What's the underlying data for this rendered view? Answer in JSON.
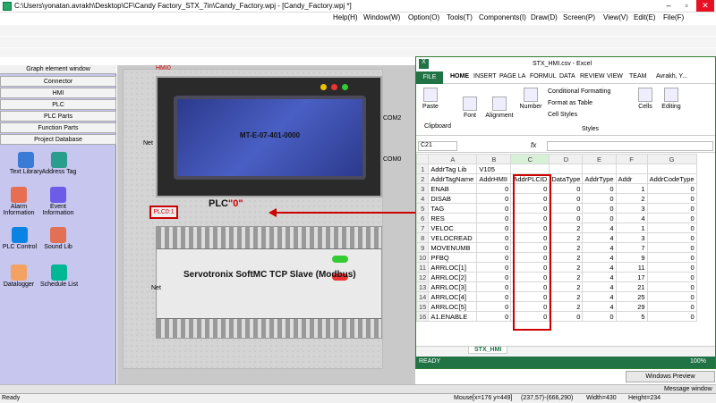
{
  "app": {
    "title": "C:\\Users\\yonatan.avrakh\\Desktop\\CF\\Candy Factory_STX_7in\\Candy_Factory.wpj - [Candy_Factory.wpj *]"
  },
  "menu": [
    "Help(H)",
    "Window(W)",
    "Option(O)",
    "Tools(T)",
    "Components(I)",
    "Draw(D)",
    "Screen(P)",
    "View(V)",
    "Edit(E)",
    "File(F)"
  ],
  "sidebar": {
    "header": "Graph element window",
    "sections": [
      "Connector",
      "HMI",
      "PLC",
      "PLC Parts",
      "Function Parts",
      "Project Database"
    ],
    "tools": [
      {
        "label": "Text Library",
        "icon": "text-library-icon",
        "color": "#3a7bd5"
      },
      {
        "label": "Address Tag",
        "icon": "address-tag-icon",
        "color": "#2a9d8f"
      },
      {
        "label": "Alarm\nInformation",
        "icon": "alarm-icon",
        "color": "#e76f51"
      },
      {
        "label": "Event\nInformation",
        "icon": "event-icon",
        "color": "#6c5ce7"
      },
      {
        "label": "PLC Control",
        "icon": "plc-control-icon",
        "color": "#0984e3"
      },
      {
        "label": "Sound Lib",
        "icon": "sound-icon",
        "color": "#e17055"
      },
      {
        "label": "Datalogger",
        "icon": "datalogger-icon",
        "color": "#f4a261"
      },
      {
        "label": "Schedule List",
        "icon": "schedule-icon",
        "color": "#00b894"
      }
    ]
  },
  "canvas": {
    "hmi_label": "HMI0",
    "hmi_text": "MT-E-07-401-0000",
    "com2": "COM2",
    "com0": "COM0",
    "net1": "Net",
    "net2": "Net",
    "plc_label_prefix": "PLC",
    "plc_label_value": "\"0\"",
    "plc_box": "PLC0:1",
    "plc_text": "Servotronix SoftMC TCP Slave (Modbus)"
  },
  "excel": {
    "title": "STX_HMI.csv - Excel",
    "user": "Avrakh, Y...",
    "tabs": [
      "FILE",
      "HOME",
      "INSERT",
      "PAGE LA",
      "FORMUL",
      "DATA",
      "REVIEW",
      "VIEW",
      "TEAM"
    ],
    "ribbon": {
      "paste": "Paste",
      "clipboard": "Clipboard",
      "font": "Font",
      "alignment": "Alignment",
      "number": "Number",
      "cond": "Conditional Formatting",
      "fmt_table": "Format as Table",
      "cell_styles": "Cell Styles",
      "styles": "Styles",
      "cells": "Cells",
      "editing": "Editing"
    },
    "namebox": "C21",
    "fx": "fx",
    "columns": [
      "",
      "A",
      "B",
      "C",
      "D",
      "E",
      "F",
      "G"
    ],
    "rows": [
      [
        "1",
        "AddrTag Lib",
        "V105",
        "",
        "",
        "",
        "",
        ""
      ],
      [
        "2",
        "AddrTagName",
        "AddrHMII",
        "AddrPLCID",
        "DataType",
        "AddrType",
        "Addr",
        "AddrCodeType"
      ],
      [
        "3",
        "ENAB",
        "0",
        "0",
        "0",
        "0",
        "1",
        "0"
      ],
      [
        "4",
        "DISAB",
        "0",
        "0",
        "0",
        "0",
        "2",
        "0"
      ],
      [
        "5",
        "TAG",
        "0",
        "0",
        "0",
        "0",
        "3",
        "0"
      ],
      [
        "6",
        "RES",
        "0",
        "0",
        "0",
        "0",
        "4",
        "0"
      ],
      [
        "7",
        "VELOC",
        "0",
        "0",
        "2",
        "4",
        "1",
        "0"
      ],
      [
        "8",
        "VELOCREAD",
        "0",
        "0",
        "2",
        "4",
        "3",
        "0"
      ],
      [
        "9",
        "MOVENUMB",
        "0",
        "0",
        "2",
        "4",
        "7",
        "0"
      ],
      [
        "10",
        "PFBQ",
        "0",
        "0",
        "2",
        "4",
        "9",
        "0"
      ],
      [
        "11",
        "ARRLOC[1]",
        "0",
        "0",
        "2",
        "4",
        "11",
        "0"
      ],
      [
        "12",
        "ARRLOC[2]",
        "0",
        "0",
        "2",
        "4",
        "17",
        "0"
      ],
      [
        "13",
        "ARRLOC[3]",
        "0",
        "0",
        "2",
        "4",
        "21",
        "0"
      ],
      [
        "14",
        "ARRLOC[4]",
        "0",
        "0",
        "2",
        "4",
        "25",
        "0"
      ],
      [
        "15",
        "ARRLOC[5]",
        "0",
        "0",
        "2",
        "4",
        "29",
        "0"
      ],
      [
        "16",
        "A1.ENABLE",
        "0",
        "0",
        "0",
        "0",
        "5",
        "0"
      ]
    ],
    "sheet": "STX_HMI",
    "status": "READY",
    "zoom": "100%"
  },
  "statusbar": {
    "ready": "Ready",
    "mouse": "Mouse[x=176  y=449]",
    "coords": "(237,57)-(666,290)",
    "width": "Width=430",
    "height": "Height=234"
  },
  "windows_preview": "Windows Preview",
  "message_window": "Message window"
}
